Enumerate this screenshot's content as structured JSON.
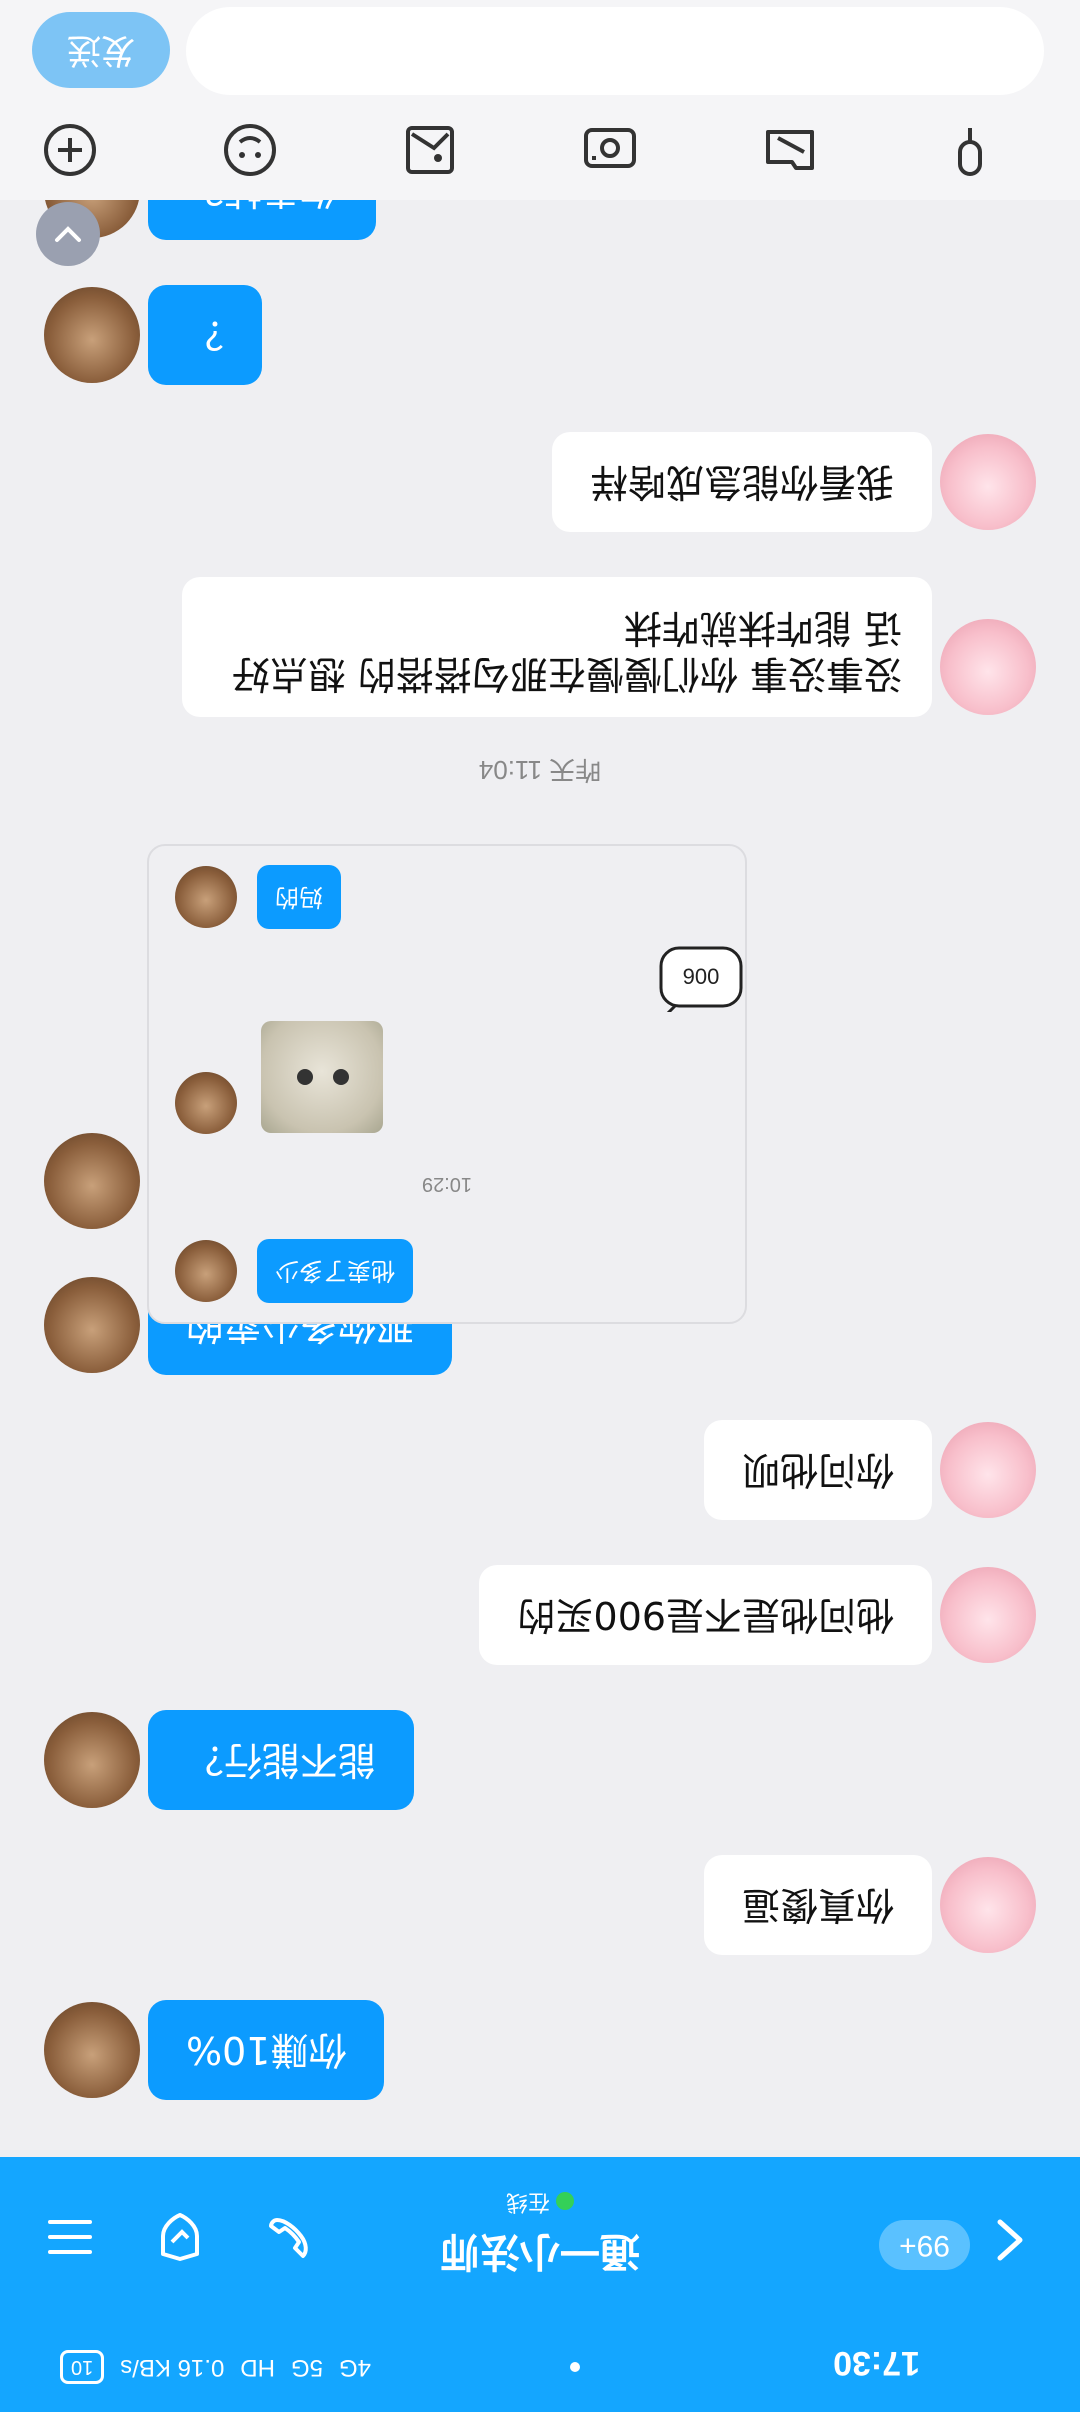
{
  "status_bar": {
    "time": "17:30",
    "network": "4G",
    "signal": "5G",
    "speed": "0.16 KB/s",
    "hd": "HD",
    "battery": "10"
  },
  "header": {
    "title": "通一小法师",
    "status": "在线",
    "unread": "99+"
  },
  "messages": [
    {
      "side": "friend",
      "text": "你赚10%"
    },
    {
      "side": "me",
      "text": "你真傻逼"
    },
    {
      "side": "friend",
      "text": "能不能行？"
    },
    {
      "side": "me",
      "text": "他问他是不是900买的"
    },
    {
      "side": "me",
      "text": "你问他呗"
    },
    {
      "side": "friend",
      "text": "那你多少卖的"
    },
    {
      "side": "me",
      "text": "没事没事 你们慢慢在那勾搭搭的 想点好话 能咋抹就咋抹"
    },
    {
      "side": "me",
      "text": "我看你能急成啥样"
    },
    {
      "side": "friend",
      "text": "？"
    },
    {
      "side": "friend",
      "text": "你卖掉？"
    }
  ],
  "divider_time": "昨天 11:04",
  "forward_card": {
    "msg1": "他卖了多少",
    "time": "10:29",
    "sticker": "900",
    "msg2": "妈的"
  },
  "composer": {
    "placeholder": "",
    "send_label": "发送"
  },
  "colors": {
    "brand": "#14a6ff",
    "friend_bubble": "#0c9bff",
    "my_bubble": "#ffffff"
  }
}
